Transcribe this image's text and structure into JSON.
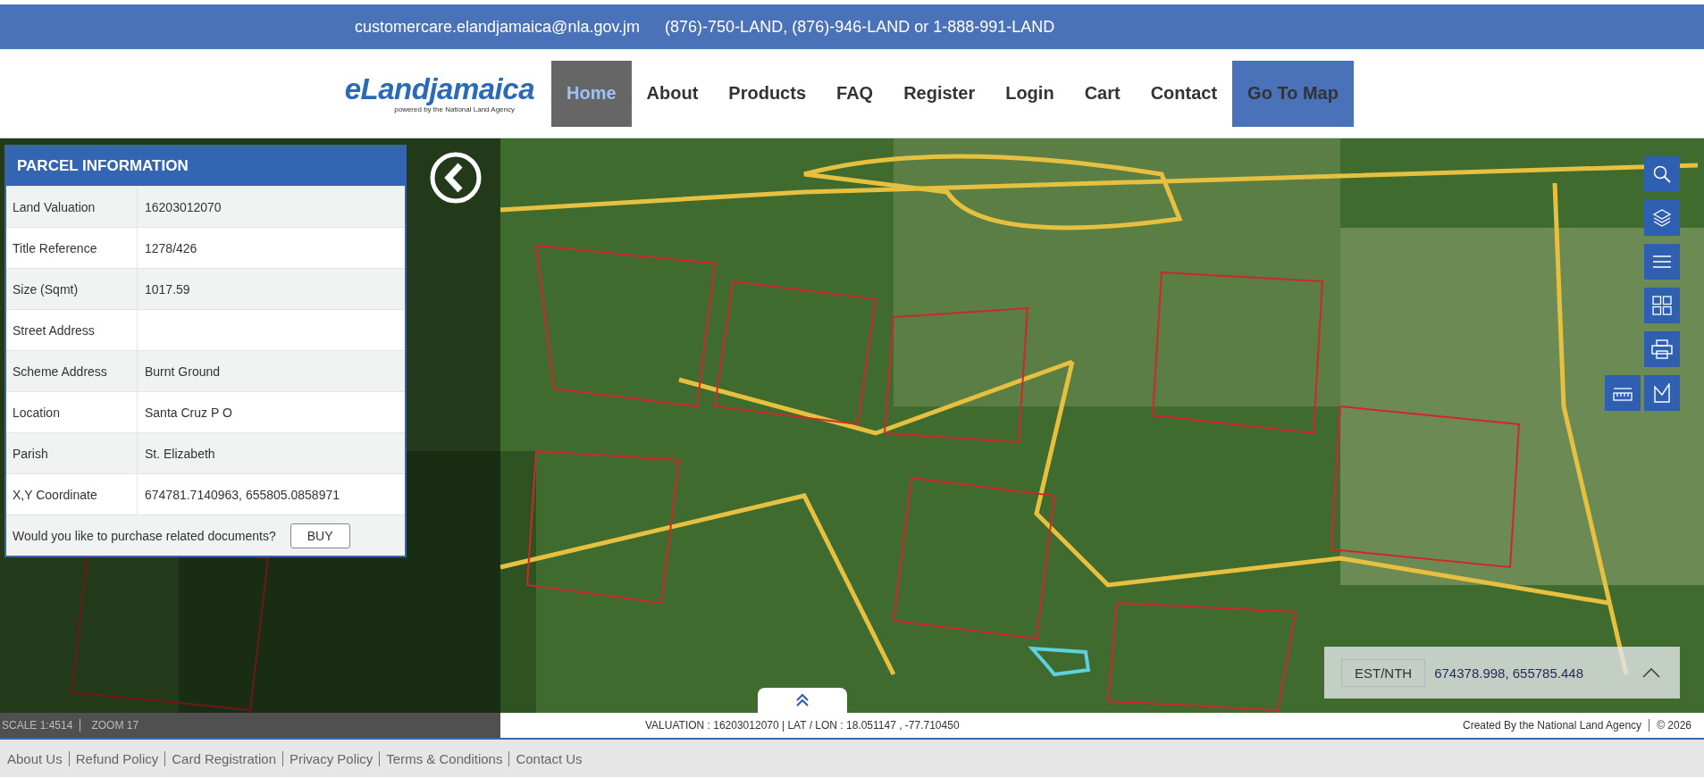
{
  "contact_bar": {
    "email": "customercare.elandjamaica@nla.gov.jm",
    "phones": "(876)-750-LAND, (876)-946-LAND or 1-888-991-LAND"
  },
  "logo": {
    "name": "eLandjamaica",
    "tagline": "powered by the National Land Agency"
  },
  "nav": [
    {
      "label": "Home",
      "selected": true,
      "kind": "link"
    },
    {
      "label": "About",
      "selected": false,
      "kind": "link"
    },
    {
      "label": "Products",
      "selected": false,
      "kind": "link"
    },
    {
      "label": "FAQ",
      "selected": false,
      "kind": "link"
    },
    {
      "label": "Register",
      "selected": false,
      "kind": "link"
    },
    {
      "label": "Login",
      "selected": false,
      "kind": "link"
    },
    {
      "label": "Cart",
      "selected": false,
      "kind": "link"
    },
    {
      "label": "Contact",
      "selected": false,
      "kind": "link"
    },
    {
      "label": "Go To Map",
      "selected": false,
      "kind": "cta"
    }
  ],
  "parcel_panel": {
    "title": "PARCEL INFORMATION",
    "rows": [
      {
        "label": "Land Valuation",
        "value": "16203012070"
      },
      {
        "label": "Title Reference",
        "value": "1278/426"
      },
      {
        "label": "Size (Sqmt)",
        "value": "1017.59"
      },
      {
        "label": "Street Address"
      },
      {
        "label": "Scheme Address",
        "value": "Burnt Ground"
      },
      {
        "label": "Location",
        "value": "Santa Cruz P O"
      },
      {
        "label": "Parish",
        "value": "St. Elizabeth"
      },
      {
        "label": "X,Y Coordinate",
        "value": "674781.7140963,  655805.0858971"
      }
    ],
    "purchase_prompt": "Would you like to purchase related documents?",
    "buy_button": "BUY"
  },
  "map_tools": [
    {
      "kind": "search"
    },
    {
      "kind": "layers"
    },
    {
      "kind": "list"
    },
    {
      "kind": "grid"
    },
    {
      "kind": "print"
    }
  ],
  "map_tools_bottom": [
    {
      "kind": "measure"
    },
    {
      "kind": "draw"
    }
  ],
  "coordinates": {
    "label": "EST/NTH",
    "value": "674378.998, 655785.448"
  },
  "status": {
    "scale": "SCALE 1:4514",
    "zoom": "ZOOM 17",
    "valuation": "VALUATION : 16203012070 | LAT / LON : 18.051147 , -77.710450",
    "credit": "Created By the National Land Agency",
    "year": "© 2026"
  },
  "footer_links": [
    "About Us",
    "Refund Policy",
    "Card Registration",
    "Privacy Policy",
    "Terms & Conditions",
    "Contact Us"
  ]
}
